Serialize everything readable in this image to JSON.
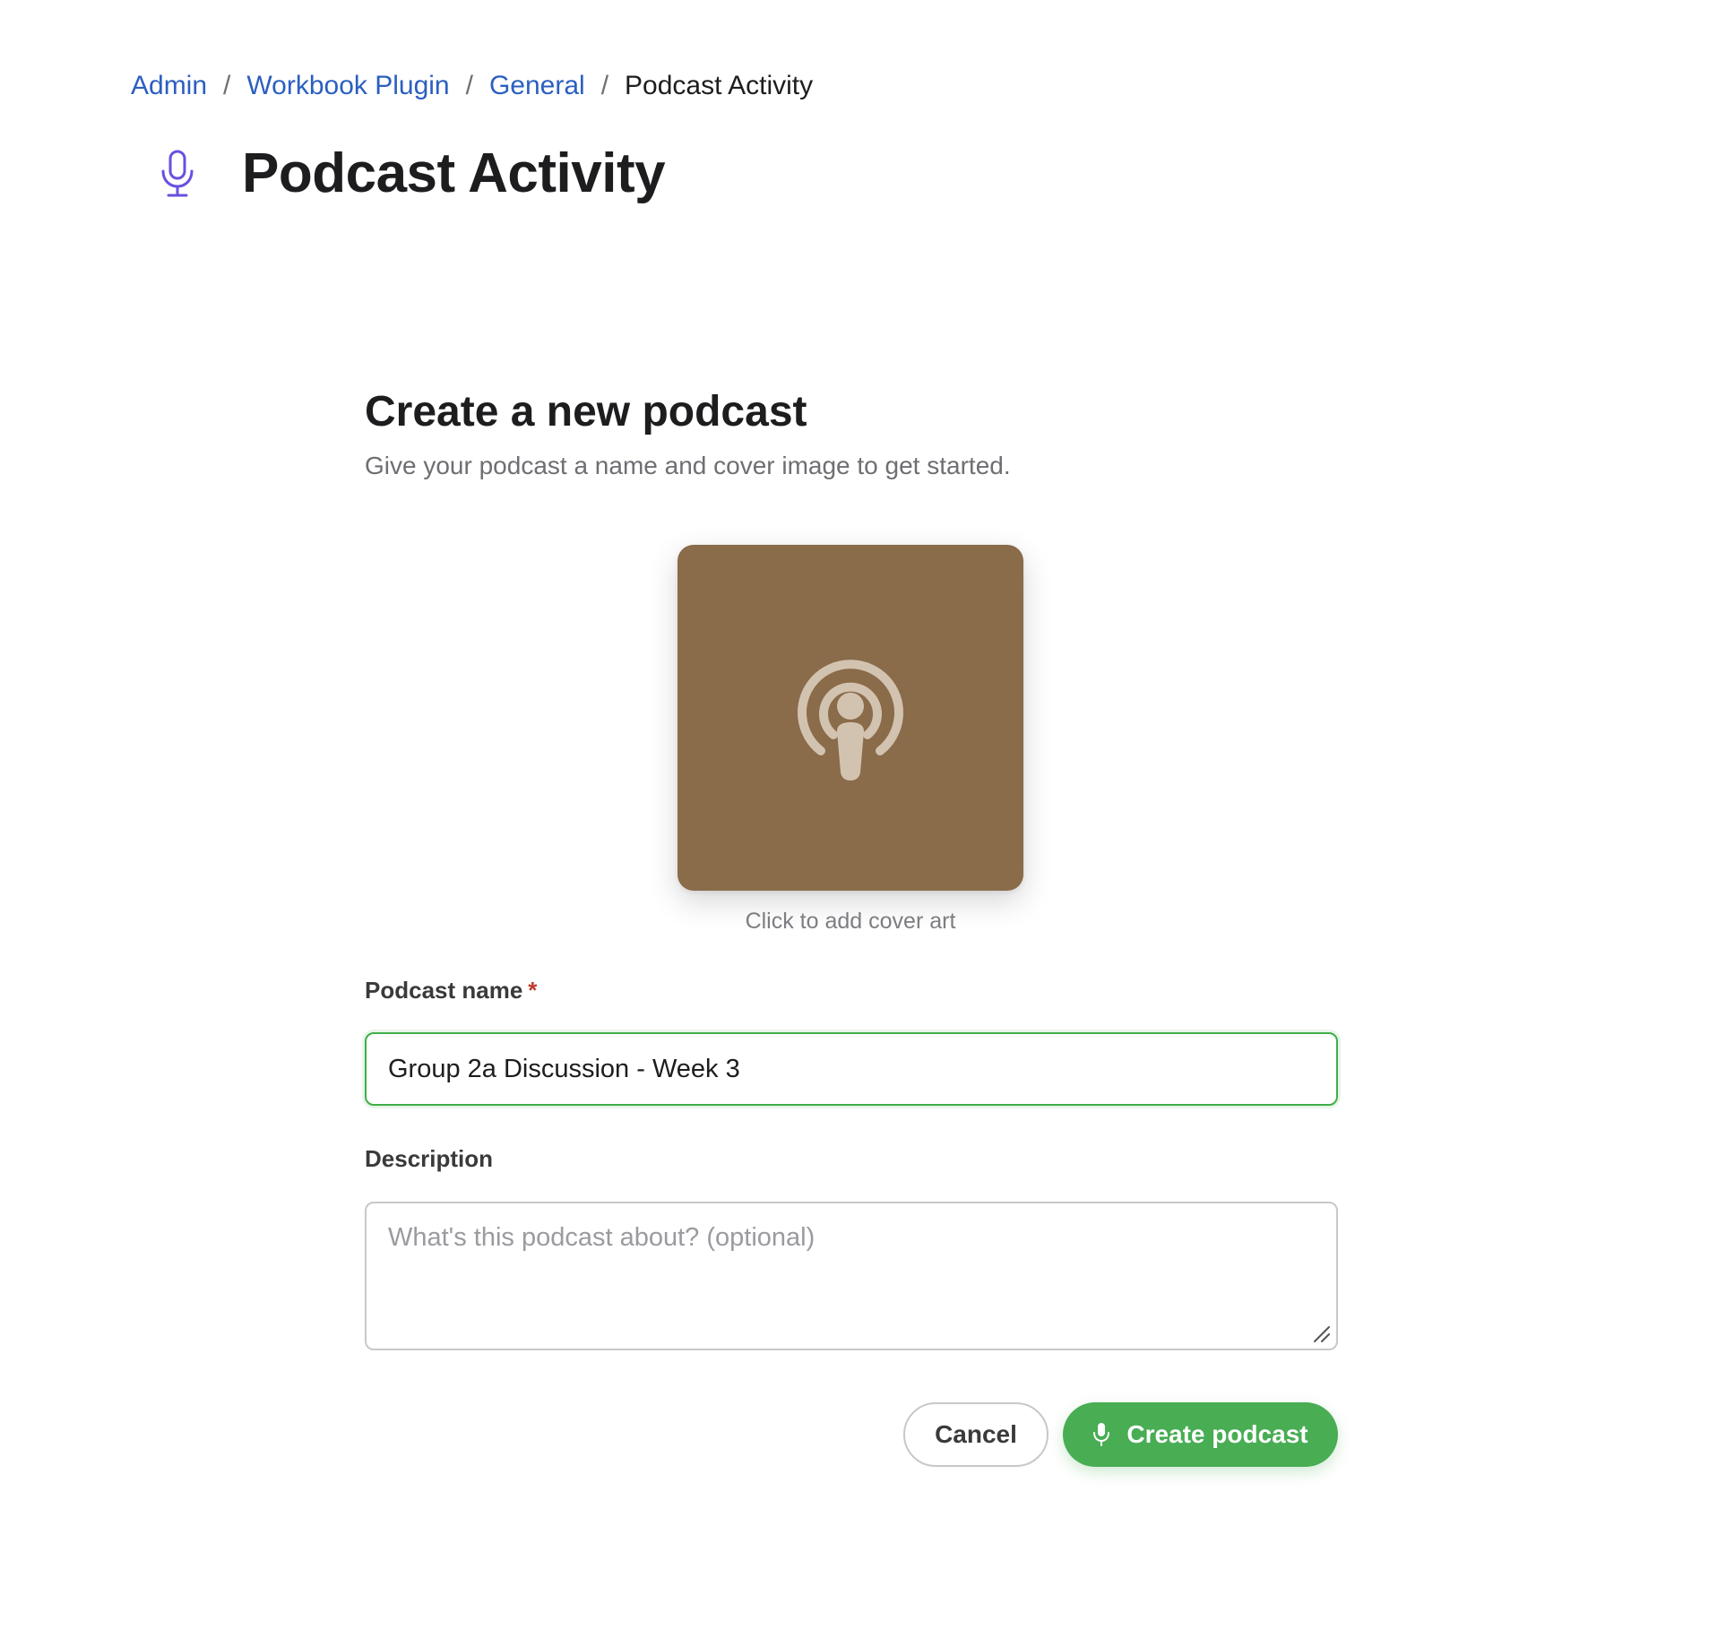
{
  "breadcrumb": {
    "items": [
      "Admin",
      "Workbook Plugin",
      "General"
    ],
    "separator": "/",
    "current": "Podcast Activity"
  },
  "page": {
    "title": "Podcast Activity",
    "icon": "microphone-icon",
    "icon_color": "#6a4fe0"
  },
  "form": {
    "title": "Create a new podcast",
    "subtitle": "Give your podcast a name and cover image to get started.",
    "cover": {
      "hint": "Click to add cover art",
      "icon": "podcast-icon",
      "background_color": "#8a6b4a"
    },
    "name_field": {
      "label": "Podcast name",
      "required_marker": "*",
      "value": "Group 2a Discussion - Week 3"
    },
    "description_field": {
      "label": "Description",
      "placeholder": "What's this podcast about? (optional)",
      "value": ""
    },
    "buttons": {
      "cancel_label": "Cancel",
      "create_label": "Create podcast",
      "create_color": "#48ad53"
    }
  }
}
